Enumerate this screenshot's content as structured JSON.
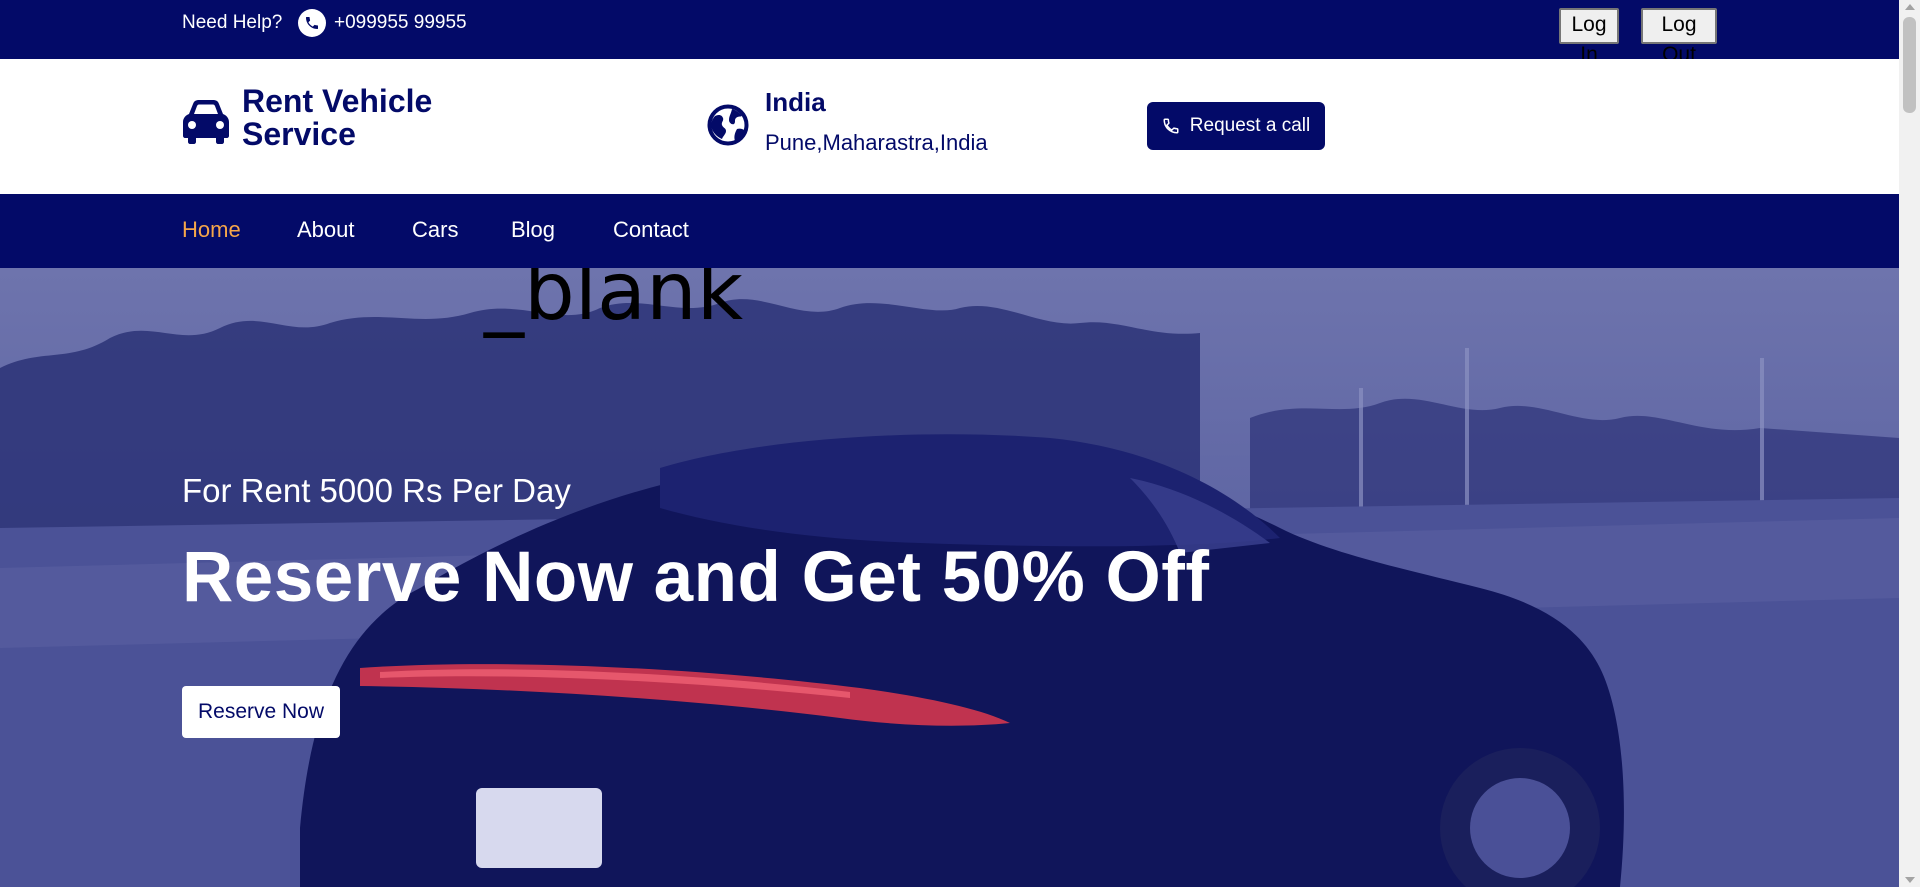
{
  "colors": {
    "navy": "#030a68",
    "accent": "#f5a64a",
    "white": "#ffffff"
  },
  "topbar": {
    "need_help": "Need Help?",
    "phone_icon": "phone-icon",
    "phone": "+099955 99955",
    "login_label": "Log In",
    "logout_label": "Log Out"
  },
  "header": {
    "brand_icon": "car-icon",
    "brand_line1": "Rent Vehicle",
    "brand_line2": "Service",
    "location_icon": "globe-icon",
    "country": "India",
    "city": "Pune,Maharastra,India",
    "request_label": "Request a call"
  },
  "nav": {
    "items": [
      {
        "label": "Home",
        "active": true
      },
      {
        "label": "About",
        "active": false
      },
      {
        "label": "Cars",
        "active": false
      },
      {
        "label": "Blog",
        "active": false
      },
      {
        "label": "Contact",
        "active": false
      }
    ]
  },
  "hero": {
    "stray_text": "_blank",
    "subtitle": "For Rent 5000 Rs Per Day",
    "title": "Reserve Now and Get 50% Off",
    "cta_label": "Reserve Now"
  }
}
